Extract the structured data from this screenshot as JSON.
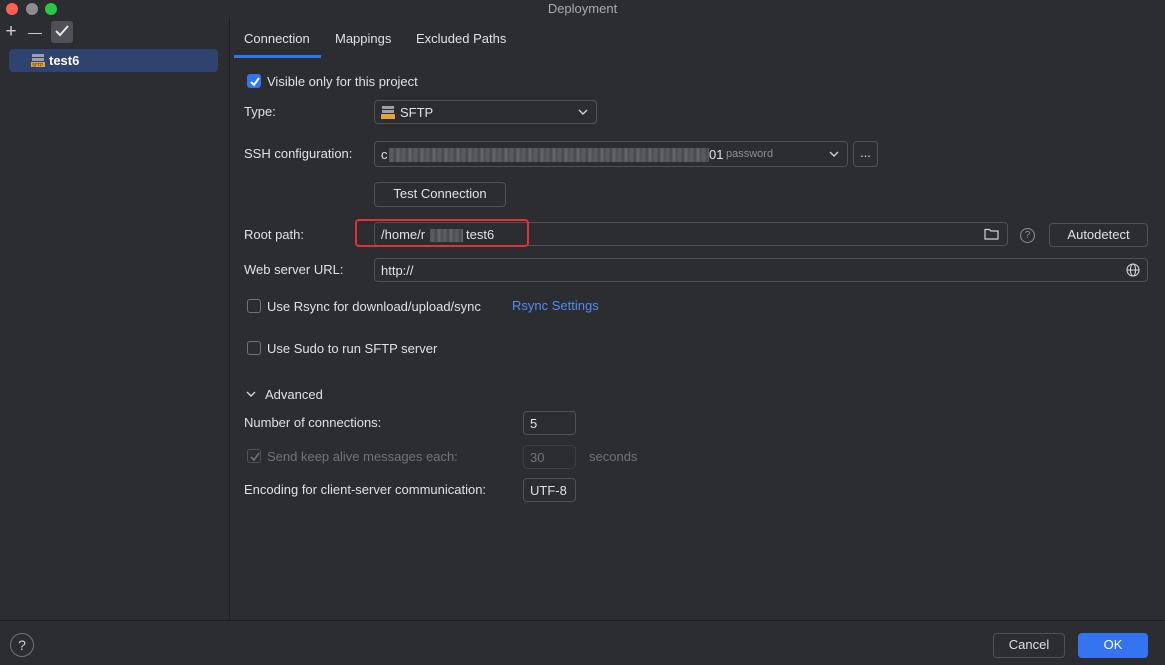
{
  "window": {
    "title": "Deployment"
  },
  "sidebar": {
    "toolbar": {
      "add": "+",
      "remove": "—"
    },
    "items": [
      {
        "label": "test6",
        "icon": "sftp-server-icon"
      }
    ]
  },
  "tabs": [
    {
      "label": "Connection",
      "selected": true
    },
    {
      "label": "Mappings",
      "selected": false
    },
    {
      "label": "Excluded Paths",
      "selected": false
    }
  ],
  "connection": {
    "visible_only": {
      "label": "Visible only for this project",
      "checked": true
    },
    "type": {
      "label": "Type:",
      "value": "SFTP"
    },
    "ssh": {
      "label": "SSH configuration:",
      "value_prefix": "c",
      "value_suffix": "01",
      "auth": "password",
      "more": "..."
    },
    "test_connection": "Test Connection",
    "root_path": {
      "label": "Root path:",
      "value_prefix": "/home/r",
      "value_suffix": "test6",
      "autodetect": "Autodetect",
      "help": "?"
    },
    "web_url": {
      "label": "Web server URL:",
      "value": "http://"
    },
    "rsync": {
      "label": "Use Rsync for download/upload/sync",
      "link": "Rsync Settings",
      "checked": false
    },
    "sudo": {
      "label": "Use Sudo to run SFTP server",
      "checked": false
    }
  },
  "advanced": {
    "title": "Advanced",
    "connections": {
      "label": "Number of connections:",
      "value": "5"
    },
    "keep_alive": {
      "label": "Send keep alive messages each:",
      "value": "30",
      "unit": "seconds",
      "checked": true,
      "enabled": false
    },
    "encoding": {
      "label": "Encoding for client-server communication:",
      "value": "UTF-8"
    }
  },
  "footer": {
    "help": "?",
    "cancel": "Cancel",
    "ok": "OK"
  },
  "colors": {
    "accent": "#3574f0",
    "highlight": "#e5303a",
    "link": "#548af7"
  }
}
